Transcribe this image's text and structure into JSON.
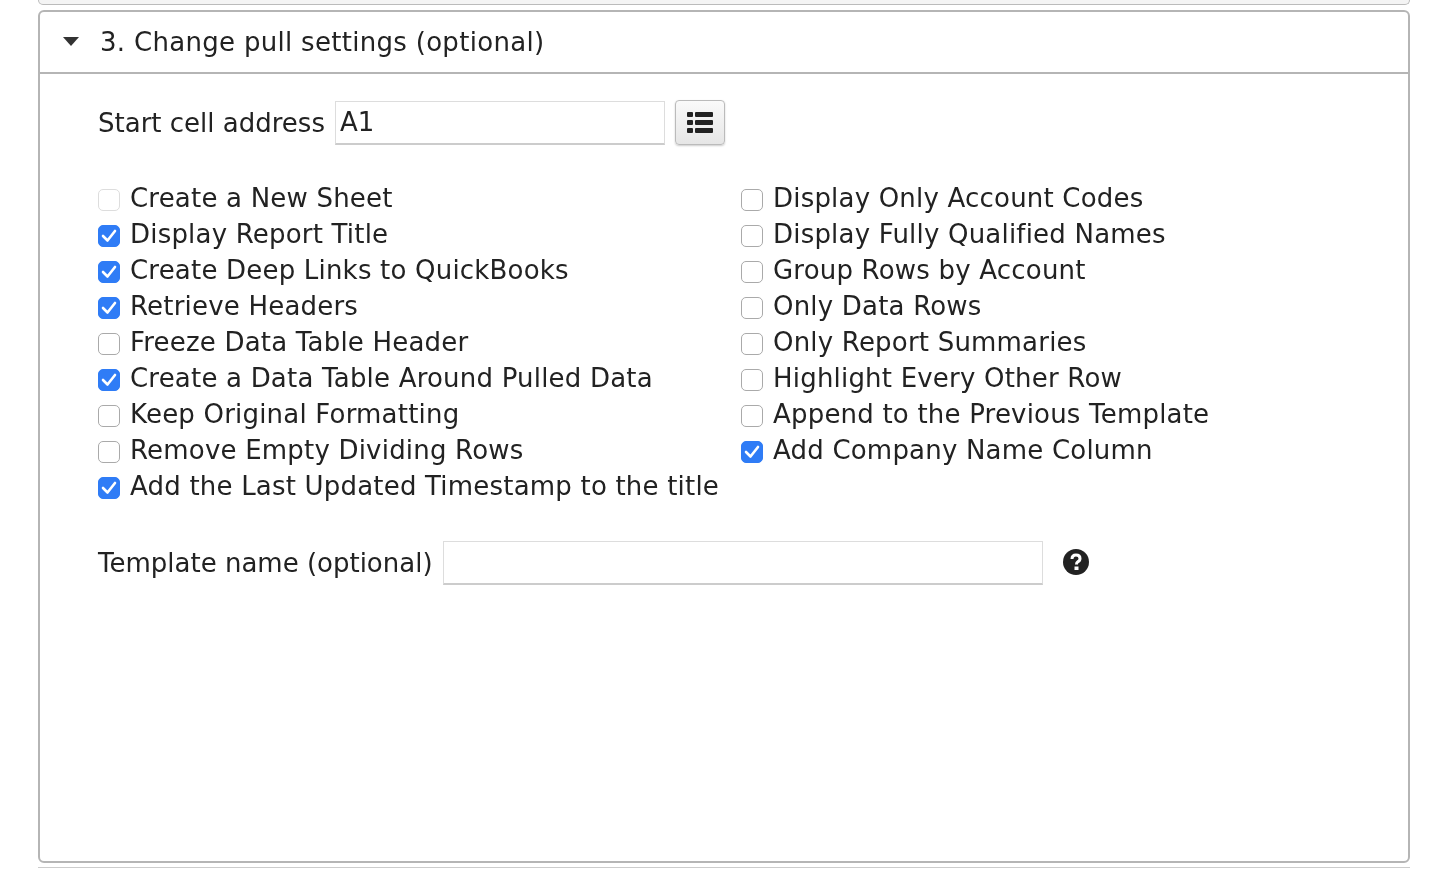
{
  "section": {
    "title": "3. Change pull settings (optional)",
    "expanded": true
  },
  "start_cell": {
    "label": "Start cell address",
    "value": "A1"
  },
  "options_left": [
    {
      "label": "Create a New Sheet",
      "checked": false,
      "disabled": true
    },
    {
      "label": "Display Report Title",
      "checked": true,
      "disabled": false
    },
    {
      "label": "Create Deep Links to QuickBooks",
      "checked": true,
      "disabled": false
    },
    {
      "label": "Retrieve Headers",
      "checked": true,
      "disabled": false
    },
    {
      "label": "Freeze Data Table Header",
      "checked": false,
      "disabled": false
    },
    {
      "label": "Create a Data Table Around Pulled Data",
      "checked": true,
      "disabled": false
    },
    {
      "label": "Keep Original Formatting",
      "checked": false,
      "disabled": false
    },
    {
      "label": "Remove Empty Dividing Rows",
      "checked": false,
      "disabled": false
    },
    {
      "label": "Add the Last Updated Timestamp to the title",
      "checked": true,
      "disabled": false
    }
  ],
  "options_right": [
    {
      "label": "Display Only Account Codes",
      "checked": false,
      "disabled": false
    },
    {
      "label": "Display Fully Qualified Names",
      "checked": false,
      "disabled": false
    },
    {
      "label": "Group Rows by Account",
      "checked": false,
      "disabled": false
    },
    {
      "label": "Only Data Rows",
      "checked": false,
      "disabled": false
    },
    {
      "label": "Only Report Summaries",
      "checked": false,
      "disabled": false
    },
    {
      "label": "Highlight Every Other Row",
      "checked": false,
      "disabled": false
    },
    {
      "label": "Append to the Previous Template",
      "checked": false,
      "disabled": false
    },
    {
      "label": "Add Company Name Column",
      "checked": true,
      "disabled": false
    }
  ],
  "template_name": {
    "label": "Template name (optional)"
  }
}
